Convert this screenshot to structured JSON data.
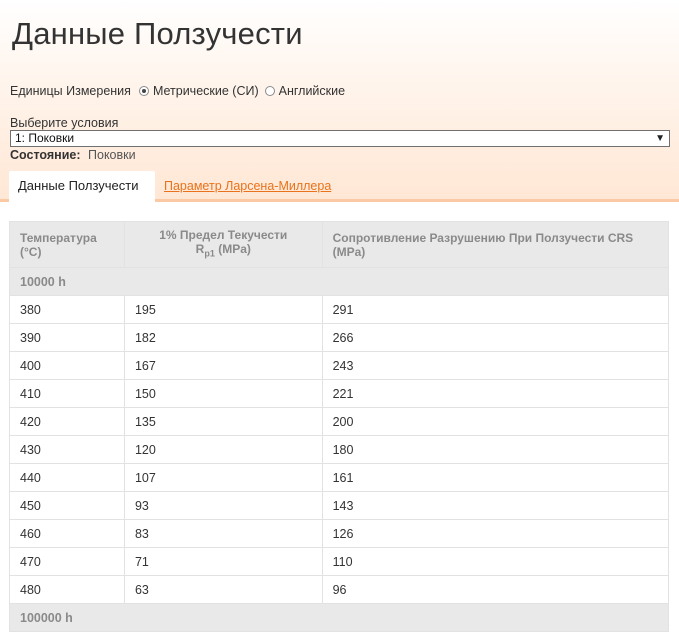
{
  "page": {
    "title": "Данные Ползучести"
  },
  "units": {
    "label": "Единицы Измерения",
    "options": [
      {
        "label": "Метрические (СИ)",
        "selected": true
      },
      {
        "label": "Английские",
        "selected": false
      }
    ]
  },
  "conditions": {
    "label": "Выберите условия",
    "selected": "1: Поковки",
    "state_label": "Состояние:",
    "state_value": "Поковки"
  },
  "tabs": {
    "active": "Данные Ползучести",
    "link": "Параметр Ларсена-Миллера"
  },
  "table": {
    "headers": {
      "temperature": "Температура (°C)",
      "yield_line1": "1% Предел Текучести",
      "yield_r": "R",
      "yield_sub": "p1",
      "yield_unit": "(MPa)",
      "crs": "Сопротивление Разрушению При Ползучести CRS (MPa)"
    },
    "groups": [
      {
        "label": "10000 h",
        "rows": [
          {
            "t": "380",
            "rp1": "195",
            "crs": "291"
          },
          {
            "t": "390",
            "rp1": "182",
            "crs": "266"
          },
          {
            "t": "400",
            "rp1": "167",
            "crs": "243"
          },
          {
            "t": "410",
            "rp1": "150",
            "crs": "221"
          },
          {
            "t": "420",
            "rp1": "135",
            "crs": "200"
          },
          {
            "t": "430",
            "rp1": "120",
            "crs": "180"
          },
          {
            "t": "440",
            "rp1": "107",
            "crs": "161"
          },
          {
            "t": "450",
            "rp1": "93",
            "crs": "143"
          },
          {
            "t": "460",
            "rp1": "83",
            "crs": "126"
          },
          {
            "t": "470",
            "rp1": "71",
            "crs": "110"
          },
          {
            "t": "480",
            "rp1": "63",
            "crs": "96"
          }
        ]
      },
      {
        "label": "100000 h",
        "rows": []
      }
    ]
  },
  "colors": {
    "accent_link": "#e8731c",
    "header_gradient_end": "#ffe7d5"
  }
}
